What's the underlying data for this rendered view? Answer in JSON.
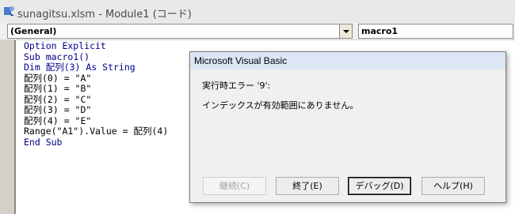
{
  "window": {
    "title": "sunagitsu.xlsm - Module1 (コード)",
    "icon": "vba-project-icon"
  },
  "selectors": {
    "object": "(General)",
    "procedure": "macro1"
  },
  "code": {
    "lines": [
      "Option Explicit",
      "Sub macro1()",
      "Dim 配列(3) As String",
      "配列(0) = \"A\"",
      "配列(1) = \"B\"",
      "配列(2) = \"C\"",
      "配列(3) = \"D\"",
      "配列(4) = \"E\"",
      "Range(\"A1\").Value = 配列(4)",
      "End Sub"
    ]
  },
  "dialog": {
    "title": "Microsoft Visual Basic",
    "error_line": "実行時エラー '9':",
    "message": "インデックスが有効範囲にありません。",
    "buttons": {
      "continue": "継続(C)",
      "end": "終了(E)",
      "debug": "デバッグ(D)",
      "help": "ヘルプ(H)"
    }
  },
  "colors": {
    "keyword": "#00008b",
    "dialog_title_bg": "#dce6f4"
  }
}
